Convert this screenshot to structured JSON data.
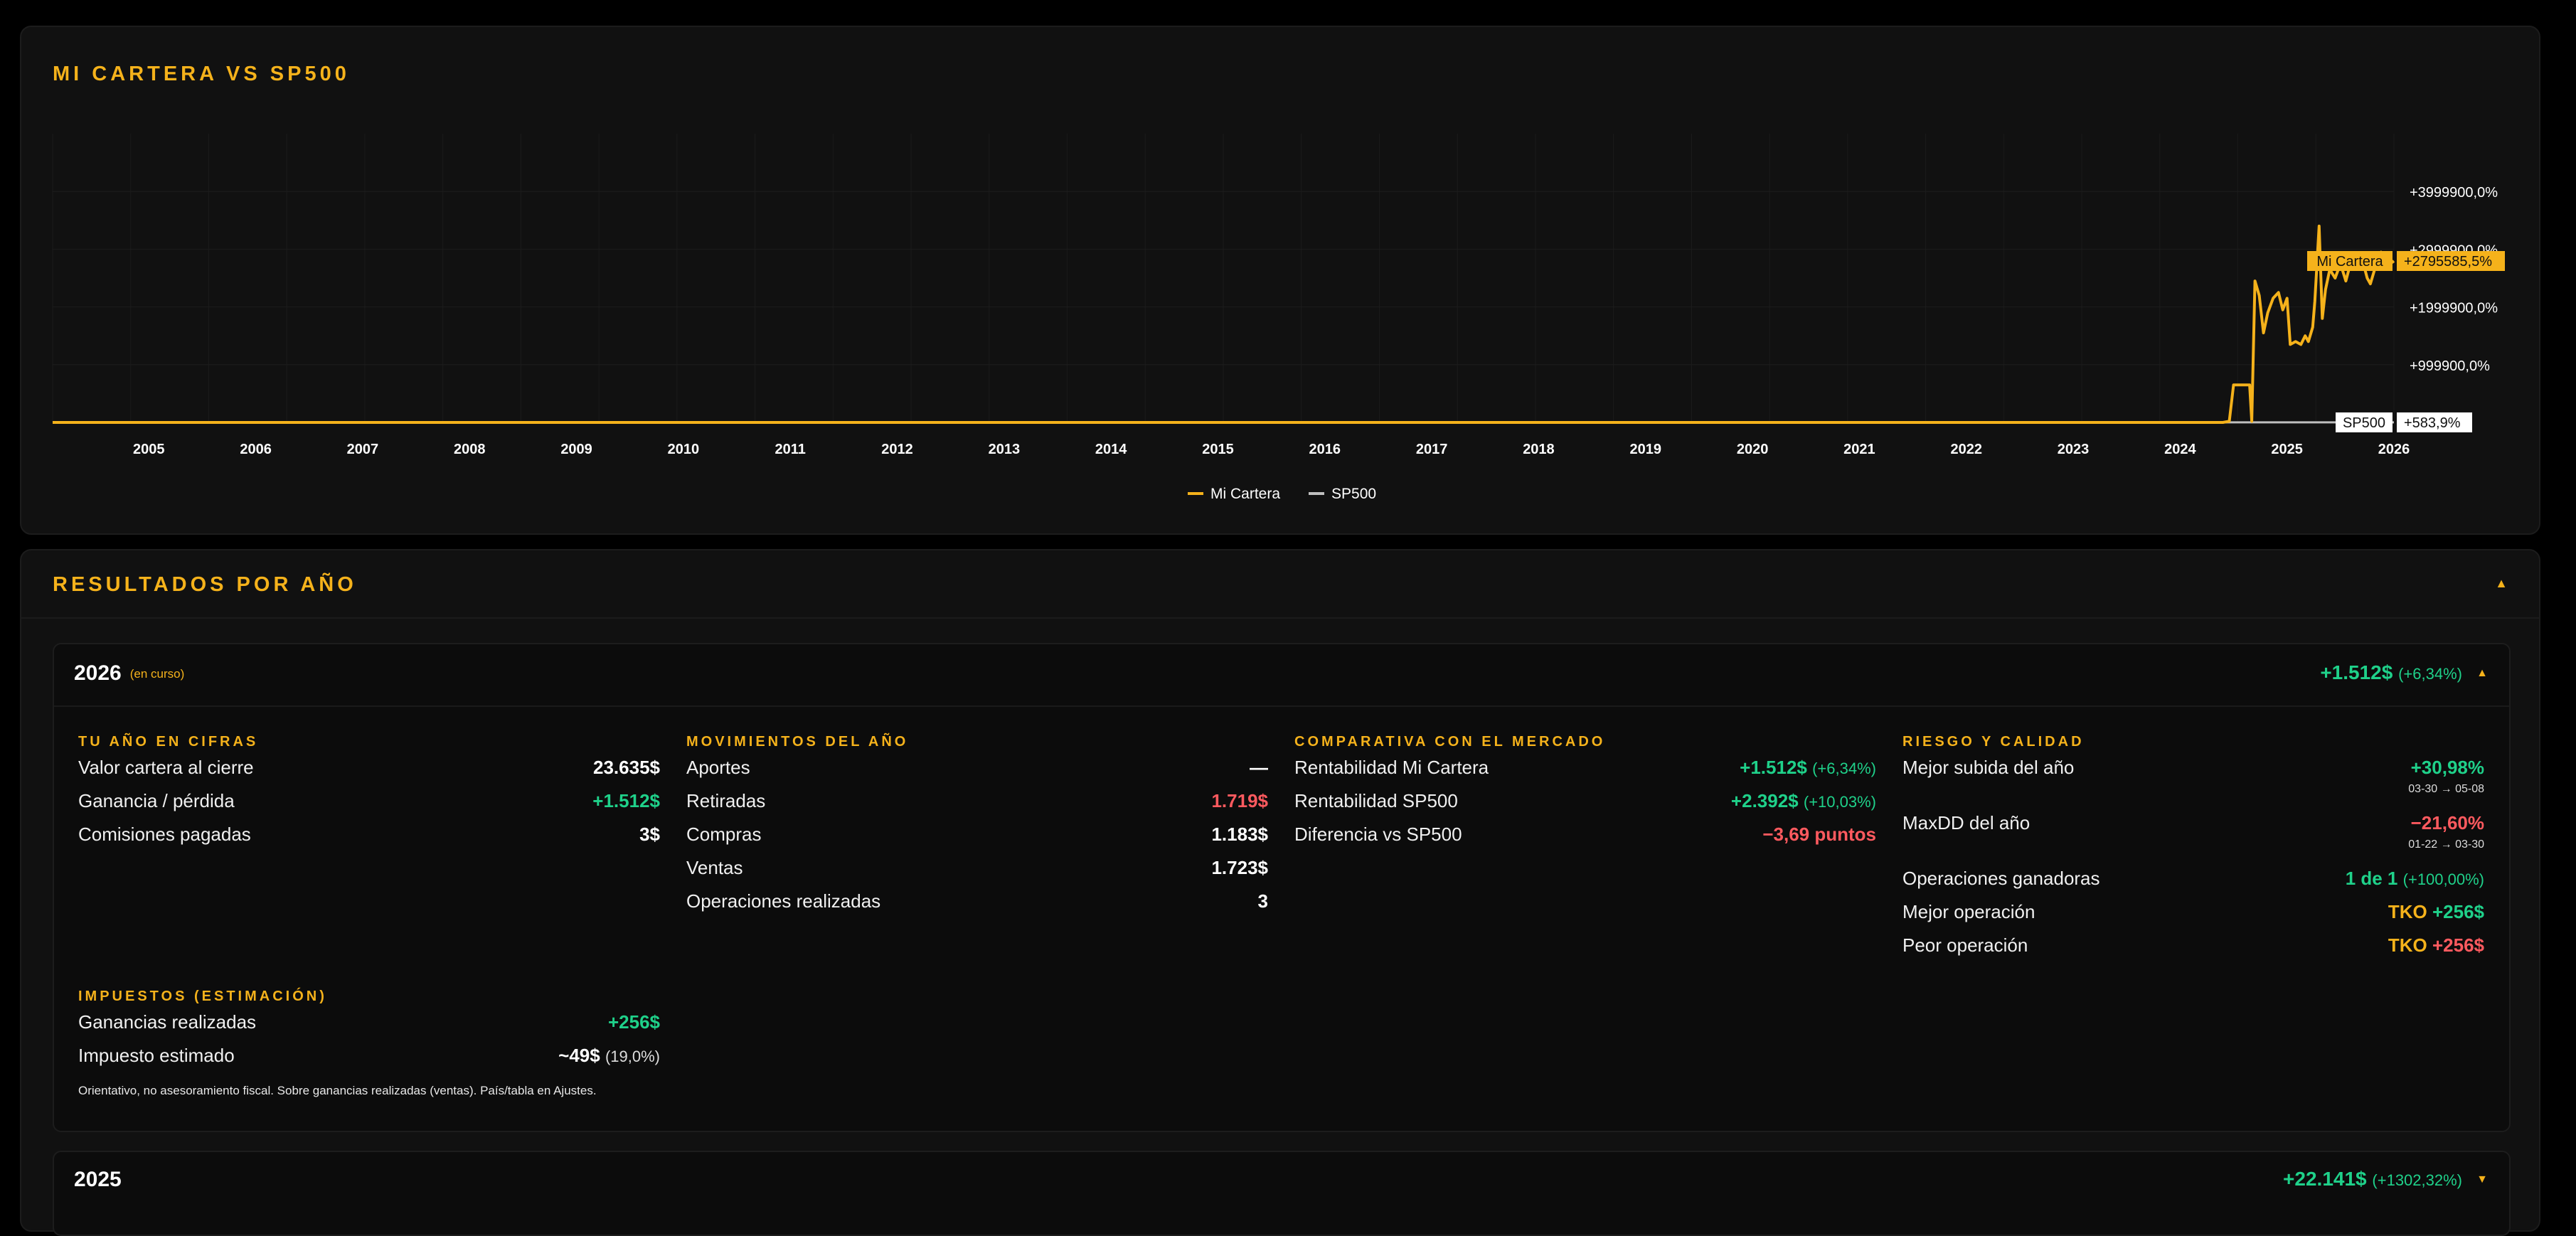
{
  "chart_panel": {
    "title": "MI CARTERA VS SP500"
  },
  "chart_data": {
    "type": "line",
    "title": "MI CARTERA VS SP500",
    "x_tick_labels": [
      "2005",
      "2006",
      "2007",
      "2008",
      "2009",
      "2010",
      "2011",
      "2012",
      "2013",
      "2014",
      "2015",
      "2016",
      "2017",
      "2018",
      "2019",
      "2020",
      "2021",
      "2022",
      "2023",
      "2024",
      "2025",
      "2026"
    ],
    "y_tick_labels": [
      "+3999900,0%",
      "+2999900,0%",
      "+1999900,0%",
      "+999900,0%"
    ],
    "y_ticks": [
      3999900,
      2999900,
      1999900,
      999900
    ],
    "ylim": [
      -100,
      4999900
    ],
    "xlim": [
      2004.6,
      2026.5
    ],
    "grid": true,
    "legend": "bottom-center",
    "series": [
      {
        "name": "Mi Cartera",
        "color": "#f5b21b",
        "last_value_label": "+2795585,5%",
        "points": [
          [
            2004.6,
            0
          ],
          [
            2024.9,
            0
          ],
          [
            2024.96,
            20000
          ],
          [
            2025.0,
            650000
          ],
          [
            2025.15,
            650000
          ],
          [
            2025.17,
            20000
          ],
          [
            2025.2,
            2450000
          ],
          [
            2025.24,
            2200000
          ],
          [
            2025.28,
            1550000
          ],
          [
            2025.32,
            1900000
          ],
          [
            2025.37,
            2150000
          ],
          [
            2025.42,
            2250000
          ],
          [
            2025.46,
            1950000
          ],
          [
            2025.5,
            2150000
          ],
          [
            2025.53,
            1350000
          ],
          [
            2025.58,
            1400000
          ],
          [
            2025.63,
            1350000
          ],
          [
            2025.67,
            1500000
          ],
          [
            2025.7,
            1400000
          ],
          [
            2025.74,
            1650000
          ],
          [
            2025.76,
            2100000
          ],
          [
            2025.8,
            3400000
          ],
          [
            2025.83,
            1800000
          ],
          [
            2025.86,
            2300000
          ],
          [
            2025.9,
            2650000
          ],
          [
            2025.95,
            2500000
          ],
          [
            2026.0,
            2750000
          ],
          [
            2026.05,
            2450000
          ],
          [
            2026.1,
            2800000
          ],
          [
            2026.15,
            2650000
          ],
          [
            2026.2,
            2850000
          ],
          [
            2026.25,
            2500000
          ],
          [
            2026.28,
            2400000
          ],
          [
            2026.32,
            2650000
          ],
          [
            2026.38,
            2950000
          ],
          [
            2026.43,
            2700000
          ],
          [
            2026.5,
            2795585.5
          ]
        ]
      },
      {
        "name": "SP500",
        "color": "#bfbfbf",
        "last_value_label": "+583,9%",
        "points": [
          [
            2004.6,
            0
          ],
          [
            2026.5,
            583.9
          ]
        ]
      }
    ]
  },
  "results_panel": {
    "title": "RESULTADOS POR AÑO",
    "toggle": "▲"
  },
  "years": {
    "y2026": {
      "year": "2026",
      "tag": "(en curso)",
      "total": "+1.512$",
      "total_pct": "(+6,34%)",
      "toggle": "▲",
      "cifras": {
        "title": "TU AÑO EN CIFRAS",
        "rows": [
          {
            "label": "Valor cartera al cierre",
            "value": "23.635$"
          },
          {
            "label": "Ganancia / pérdida",
            "value": "+1.512$"
          },
          {
            "label": "Comisiones pagadas",
            "value": "3$"
          }
        ]
      },
      "movimientos": {
        "title": "MOVIMIENTOS DEL AÑO",
        "rows": [
          {
            "label": "Aportes",
            "value": "—"
          },
          {
            "label": "Retiradas",
            "value": "1.719$"
          },
          {
            "label": "Compras",
            "value": "1.183$"
          },
          {
            "label": "Ventas",
            "value": "1.723$"
          },
          {
            "label": "Operaciones realizadas",
            "value": "3"
          }
        ]
      },
      "comparativa": {
        "title": "COMPARATIVA CON EL MERCADO",
        "rows": [
          {
            "label": "Rentabilidad Mi Cartera",
            "value": "+1.512$",
            "pct": "(+6,34%)"
          },
          {
            "label": "Rentabilidad SP500",
            "value": "+2.392$",
            "pct": "(+10,03%)"
          },
          {
            "label": "Diferencia vs SP500",
            "value": "−3,69 puntos"
          }
        ]
      },
      "riesgo": {
        "title": "RIESGO Y CALIDAD",
        "rows": [
          {
            "label": "Mejor subida del año",
            "value": "+30,98%",
            "sub": "03-30 → 05-08"
          },
          {
            "label": "MaxDD del año",
            "value": "−21,60%",
            "sub": "01-22 → 03-30"
          },
          {
            "label": "Operaciones ganadoras",
            "value": "1 de 1",
            "pct": "(+100,00%)"
          },
          {
            "label": "Mejor operación",
            "ticker": "TKO",
            "value": "+256$"
          },
          {
            "label": "Peor operación",
            "ticker": "TKO",
            "value": "+256$"
          }
        ]
      },
      "impuestos": {
        "title": "IMPUESTOS (ESTIMACIÓN)",
        "rows": [
          {
            "label": "Ganancias realizadas",
            "value": "+256$"
          },
          {
            "label": "Impuesto estimado",
            "value": "~49$",
            "pct": "(19,0%)"
          }
        ],
        "note": "Orientativo, no asesoramiento fiscal. Sobre ganancias realizadas (ventas). País/tabla en Ajustes."
      }
    },
    "y2025": {
      "year": "2025",
      "total": "+22.141$",
      "total_pct": "(+1302,32%)",
      "toggle": "▼"
    }
  }
}
